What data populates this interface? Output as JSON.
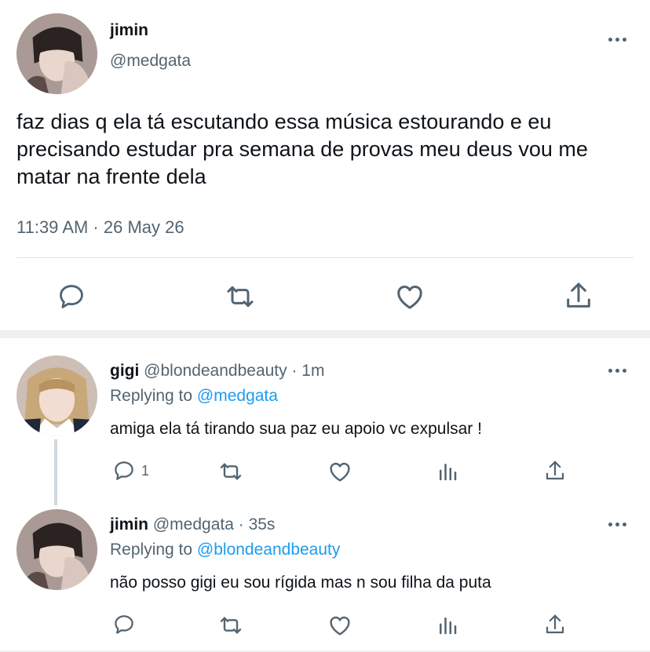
{
  "main_tweet": {
    "name": "jimin",
    "handle": "@medgata",
    "text": "faz dias q ela tá escutando essa música estourando e eu precisando estudar pra semana de provas meu deus vou me matar na frente dela",
    "timestamp": "11:39 AM · 26 May 26",
    "actions": [
      "reply-icon",
      "retweet-icon",
      "like-icon",
      "share-icon"
    ]
  },
  "replies": [
    {
      "name": "gigi",
      "handle": "@blondeandbeauty",
      "time": "· 1m",
      "replying_prefix": "Replying to",
      "replying_to": "@medgata",
      "text": "amiga ela tá tirando sua paz eu apoio vc expulsar !",
      "reply_count": "1"
    },
    {
      "name": "jimin",
      "handle": "@medgata",
      "time": "· 35s",
      "replying_prefix": "Replying to",
      "replying_to": "@blondeandbeauty",
      "text": "não posso gigi eu sou rígida mas n sou filha da puta",
      "reply_count": ""
    }
  ],
  "colors": {
    "text": "#0f1419",
    "secondary": "#536471",
    "link": "#1d9bf0",
    "divider": "#dfe3e6"
  }
}
